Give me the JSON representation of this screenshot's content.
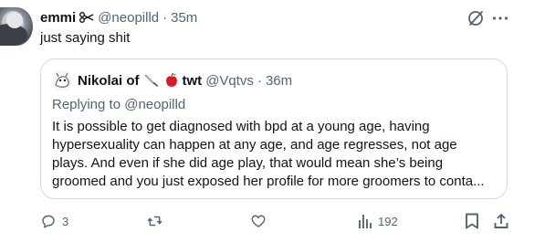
{
  "tweet": {
    "display_name": "emmi",
    "name_emoji": "scissors-emoji",
    "handle": "@neopilld",
    "separator": "·",
    "time": "35m",
    "text": "just saying shit"
  },
  "quote": {
    "display_name_part1": "Nikolai of",
    "name_emojis": [
      "knife-emoji",
      "apple-emoji"
    ],
    "display_name_part2": "twt",
    "handle": "@Vqtvs",
    "separator": "·",
    "time": "36m",
    "replying_prefix": "Replying to",
    "replying_mention": "@neopilld",
    "text_lines": [
      "It is possible to get diagnosed with bpd at a young age, having",
      "hypersexuality can happen at any age, and age regresses, not age",
      "plays. And even if she did age play, that would mean she’s being",
      "groomed and you just exposed her profile for more groomers to conta..."
    ]
  },
  "actions": {
    "reply_count": "3",
    "retweet_count": "",
    "like_count": "",
    "views_count": "192"
  },
  "colors": {
    "text": "#0f1419",
    "secondary": "#536471",
    "border": "#cfd9de",
    "background": "#ffffff"
  }
}
